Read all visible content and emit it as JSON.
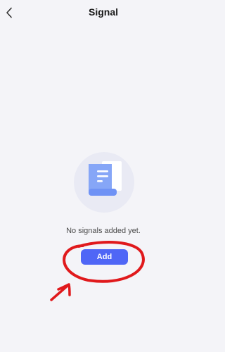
{
  "header": {
    "title": "Signal",
    "back_icon": "chevron-left-icon"
  },
  "empty_state": {
    "illustration_icon": "document-scroll-icon",
    "message": "No signals added yet."
  },
  "actions": {
    "add_label": "Add"
  },
  "colors": {
    "background": "#f4f4f8",
    "accent": "#4f66f6",
    "annotation": "#e0191c"
  }
}
